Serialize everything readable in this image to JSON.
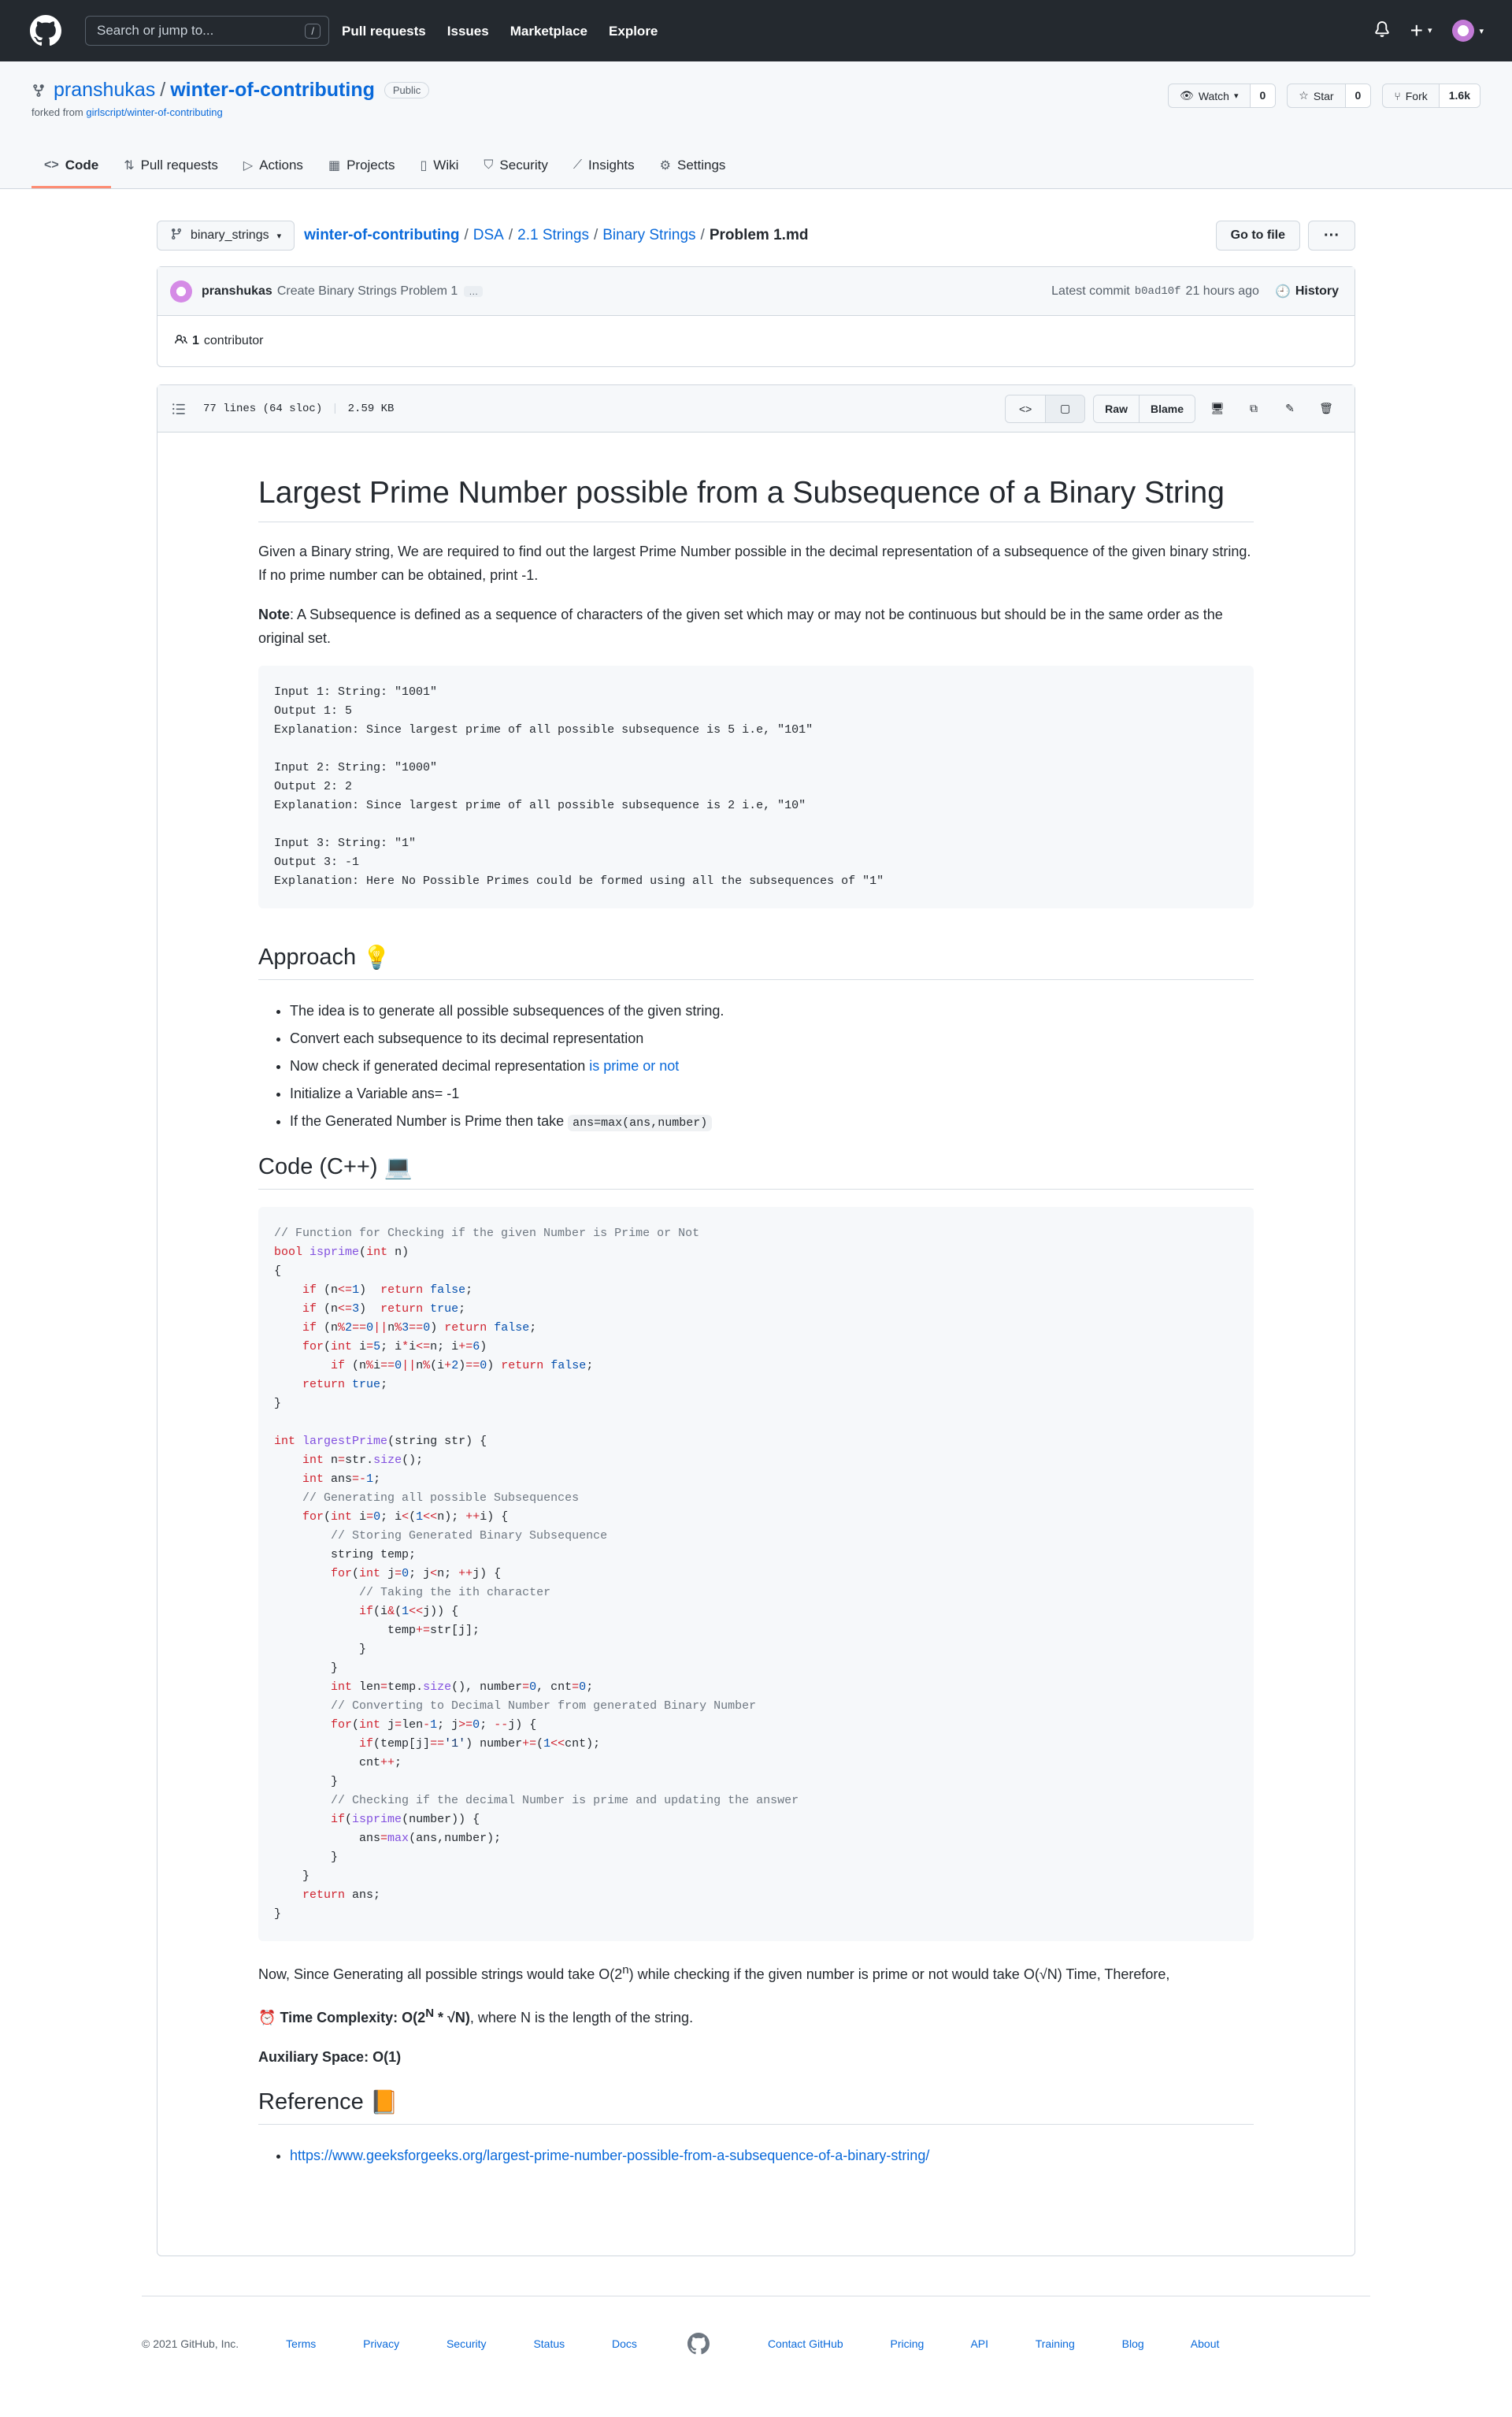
{
  "header": {
    "search_placeholder": "Search or jump to...",
    "search_key": "/",
    "nav": [
      "Pull requests",
      "Issues",
      "Marketplace",
      "Explore"
    ],
    "plus": "+"
  },
  "repo": {
    "owner": "pranshukas",
    "separator": "/",
    "name": "winter-of-contributing",
    "visibility": "Public",
    "forked_prefix": "forked from",
    "forked_source": "girlscript/winter-of-contributing",
    "watch_label": "Watch",
    "watch_count": "0",
    "star_label": "Star",
    "star_count": "0",
    "fork_label": "Fork",
    "fork_count": "1.6k",
    "tabs": [
      "Code",
      "Pull requests",
      "Actions",
      "Projects",
      "Wiki",
      "Security",
      "Insights",
      "Settings"
    ]
  },
  "file_nav": {
    "branch": "binary_strings",
    "crumbs": [
      "winter-of-contributing",
      "DSA",
      "2.1 Strings",
      "Binary Strings"
    ],
    "current": "Problem 1.md",
    "goto": "Go to file",
    "more": "···"
  },
  "commit": {
    "author": "pranshukas",
    "message": "Create Binary Strings Problem 1",
    "dots": "…",
    "latest_label": "Latest commit",
    "sha": "b0ad10f",
    "time": "21 hours ago",
    "history": "History",
    "contrib_count": "1",
    "contrib_label": "contributor"
  },
  "file_meta": {
    "lines": "77 lines (64 sloc)",
    "size": "2.59 KB",
    "raw": "Raw",
    "blame": "Blame"
  },
  "doc": {
    "title": "Largest Prime Number possible from a Subsequence of a Binary String",
    "intro": "Given a Binary string, We are required to find out the largest Prime Number possible in the decimal representation of a subsequence of the given binary string. If no prime number can be obtained, print -1.",
    "note_label": "Note",
    "note_text": ": A Subsequence is defined as a sequence of characters of the given set which may or may not be continuous but should be in the same order as the original set.",
    "examples": "Input 1: String: \"1001\"\nOutput 1: 5\nExplanation: Since largest prime of all possible subsequence is 5 i.e, \"101\"\n\nInput 2: String: \"1000\"\nOutput 2: 2\nExplanation: Since largest prime of all possible subsequence is 2 i.e, \"10\"\n\nInput 3: String: \"1\"\nOutput 3: -1\nExplanation: Here No Possible Primes could be formed using all the subsequences of \"1\"",
    "approach_title": "Approach",
    "approach_emoji": "💡",
    "approach": [
      "The idea is to generate all possible subsequences of the given string.",
      "Convert each subsequence to its decimal representation",
      "Now check if generated decimal representation ",
      "Initialize a Variable ans= -1",
      "If the Generated Number is Prime then take "
    ],
    "approach_link": "is prime or not",
    "approach_code": "ans=max(ans,number)",
    "code_title": "Code (C++)",
    "code_emoji": "💻",
    "complexity_text_a": "Now, Since Generating all possible strings would take O(2",
    "complexity_sup": "n",
    "complexity_text_b": ") while checking if the given number is prime or not would take O(√N) Time, Therefore,",
    "time_emoji": "⏰",
    "time_label": "Time Complexity:",
    "time_value_a": "O(2",
    "time_sup": "N",
    "time_value_b": " * √N)",
    "time_tail": ", where N is the length of the string.",
    "aux_label": "Auxiliary Space:",
    "aux_value": "O(1)",
    "ref_title": "Reference",
    "ref_emoji": "📙",
    "ref_link": "https://www.geeksforgeeks.org/largest-prime-number-possible-from-a-subsequence-of-a-binary-string/"
  },
  "footer": {
    "copyright": "© 2021 GitHub, Inc.",
    "left_links": [
      "Terms",
      "Privacy",
      "Security",
      "Status",
      "Docs"
    ],
    "right_links": [
      "Contact GitHub",
      "Pricing",
      "API",
      "Training",
      "Blog",
      "About"
    ]
  },
  "colors": {
    "header_bg": "#24292f",
    "link": "#0969da",
    "active_tab": "#fd8c73"
  }
}
